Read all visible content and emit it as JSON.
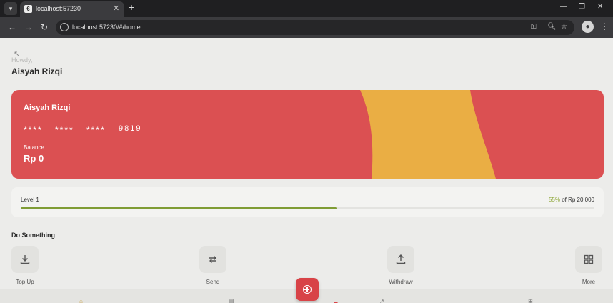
{
  "browser": {
    "tab_title": "localhost:57230",
    "url": "localhost:57230/#/home"
  },
  "header": {
    "greeting": "Howdy,",
    "name": "Aisyah Rizqi"
  },
  "card": {
    "holder": "Aisyah Rizqi",
    "mask_groups": [
      "****",
      "****",
      "****"
    ],
    "last4": "9819",
    "balance_label": "Balance",
    "balance": "Rp 0",
    "colors": {
      "base": "#db5052",
      "arc": "#eaae44"
    }
  },
  "level": {
    "name": "Level 1",
    "percent_text": "55%",
    "goal_text": "of Rp 20.000",
    "progress": 0.55
  },
  "actions": {
    "title": "Do Something",
    "items": [
      {
        "label": "Top Up",
        "icon": "download-icon"
      },
      {
        "label": "Send",
        "icon": "repeat-icon"
      },
      {
        "label": "Withdraw",
        "icon": "upload-icon"
      },
      {
        "label": "More",
        "icon": "grid-icon"
      }
    ]
  },
  "accent_color": "#d84347"
}
